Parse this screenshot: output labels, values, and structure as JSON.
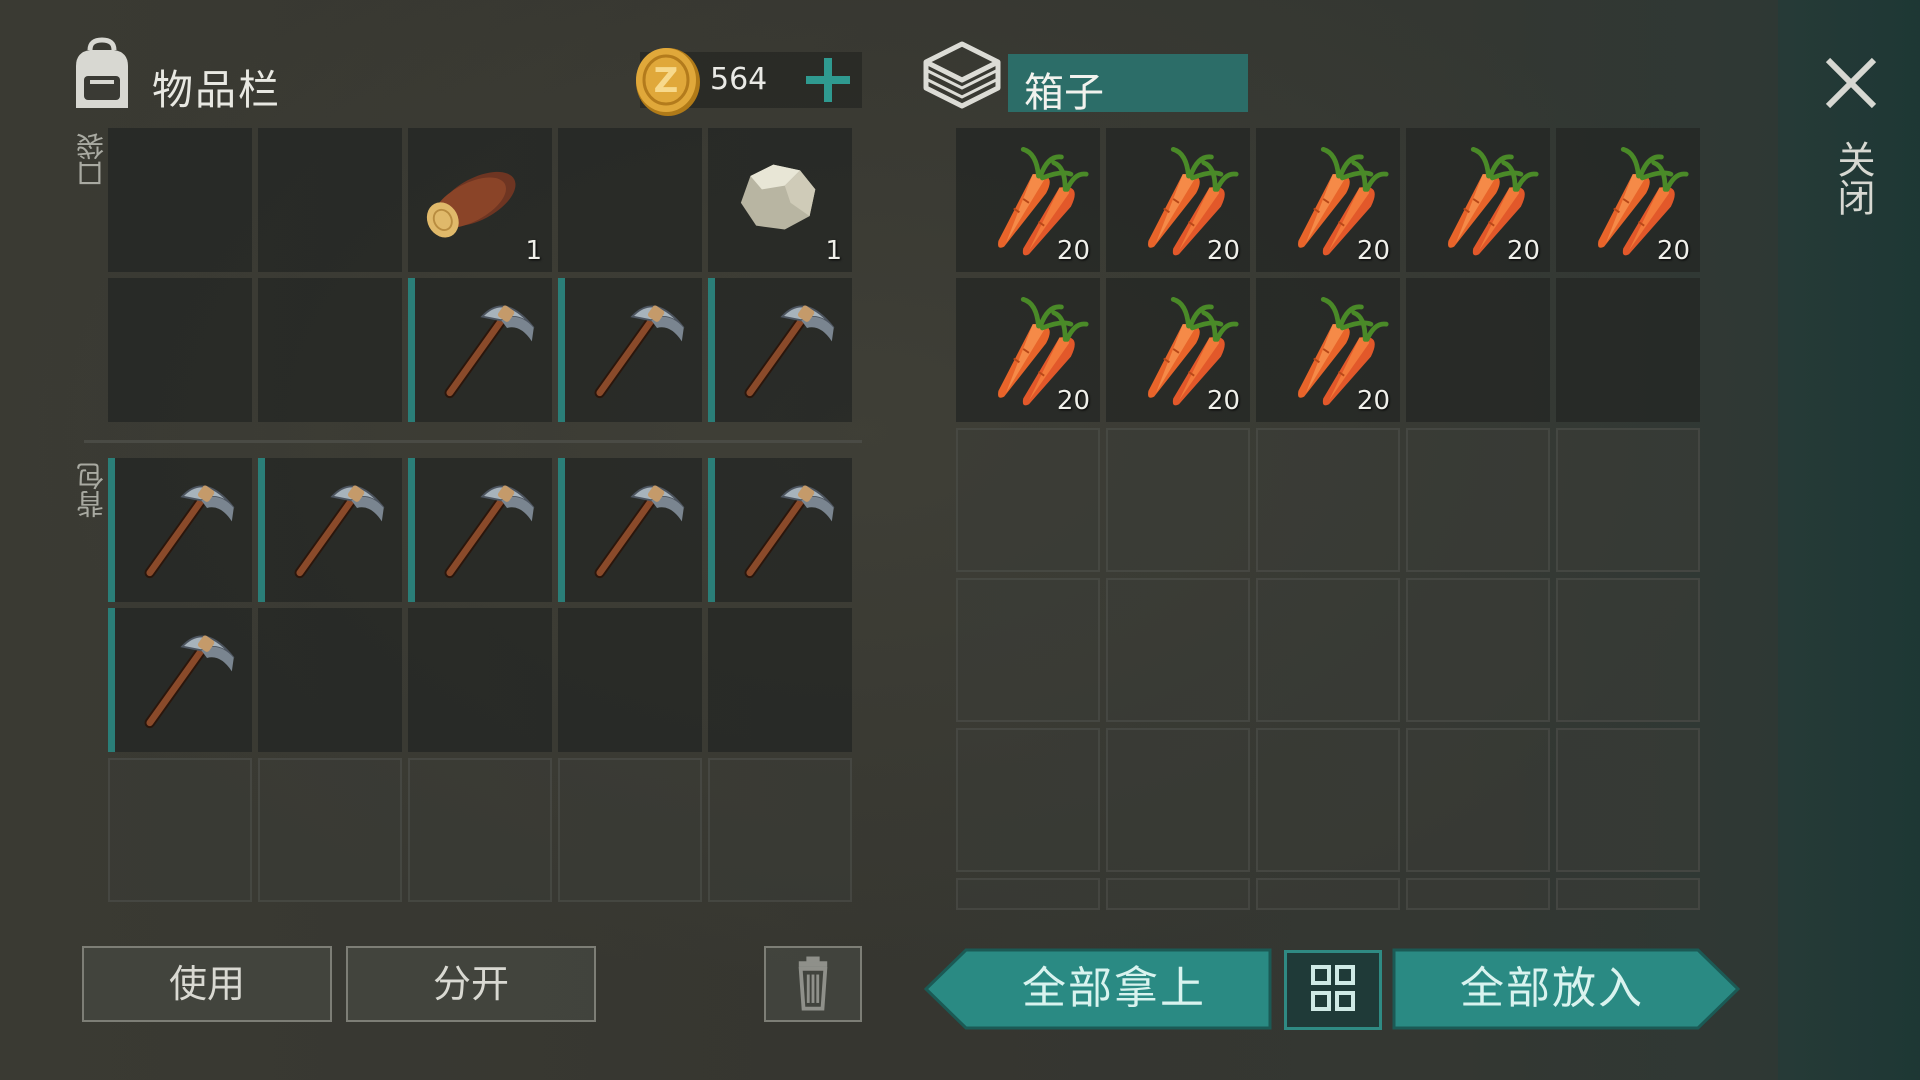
{
  "inventory": {
    "title": "物品栏",
    "coins": "564",
    "pocket_label": "口袋",
    "backpack_label": "背包",
    "pocket_slots": [
      {
        "item": "",
        "qty": ""
      },
      {
        "item": "",
        "qty": ""
      },
      {
        "item": "log",
        "qty": "1"
      },
      {
        "item": "",
        "qty": ""
      },
      {
        "item": "stone",
        "qty": "1"
      },
      {
        "item": "",
        "qty": ""
      },
      {
        "item": "",
        "qty": ""
      },
      {
        "item": "pickaxe",
        "qty": ""
      },
      {
        "item": "pickaxe",
        "qty": ""
      },
      {
        "item": "pickaxe",
        "qty": ""
      }
    ],
    "backpack_slots": [
      {
        "item": "pickaxe",
        "qty": ""
      },
      {
        "item": "pickaxe",
        "qty": ""
      },
      {
        "item": "pickaxe",
        "qty": ""
      },
      {
        "item": "pickaxe",
        "qty": ""
      },
      {
        "item": "pickaxe",
        "qty": ""
      },
      {
        "item": "pickaxe",
        "qty": ""
      },
      {
        "item": "",
        "qty": ""
      },
      {
        "item": "",
        "qty": ""
      },
      {
        "item": "",
        "qty": ""
      },
      {
        "item": "",
        "qty": ""
      },
      {
        "item": "",
        "qty": ""
      },
      {
        "item": "",
        "qty": ""
      },
      {
        "item": "",
        "qty": ""
      },
      {
        "item": "",
        "qty": ""
      },
      {
        "item": "",
        "qty": ""
      }
    ],
    "use_label": "使用",
    "split_label": "分开"
  },
  "chest": {
    "title": "箱子",
    "slots": [
      {
        "item": "carrot",
        "qty": "20"
      },
      {
        "item": "carrot",
        "qty": "20"
      },
      {
        "item": "carrot",
        "qty": "20"
      },
      {
        "item": "carrot",
        "qty": "20"
      },
      {
        "item": "carrot",
        "qty": "20"
      },
      {
        "item": "carrot",
        "qty": "20"
      },
      {
        "item": "carrot",
        "qty": "20"
      },
      {
        "item": "carrot",
        "qty": "20"
      },
      {
        "item": "",
        "qty": ""
      },
      {
        "item": "",
        "qty": ""
      }
    ],
    "take_all_label": "全部拿上",
    "put_all_label": "全部放入"
  },
  "close_label": "关闭",
  "icons": {
    "backpack": "backpack-icon",
    "coin": "coin-icon",
    "chest": "chest-icon",
    "close": "close-icon",
    "trash": "trash-icon",
    "sort": "sort-grid-icon"
  },
  "colors": {
    "accent": "#2c7f78",
    "carrot": "#e8642a",
    "coin": "#d9a030"
  }
}
